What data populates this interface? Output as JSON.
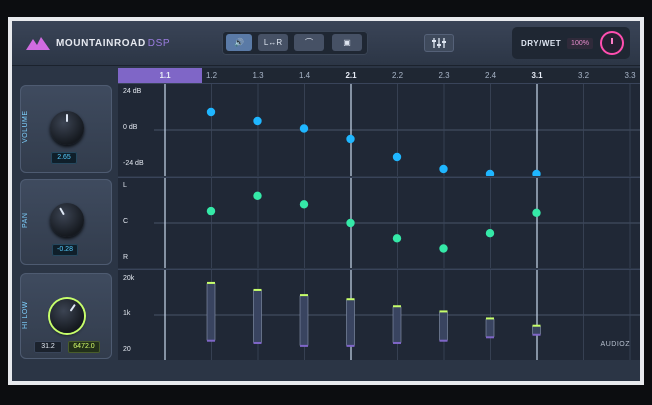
{
  "header": {
    "brand": "MOUNTAINROAD",
    "brand_suffix": "DSP",
    "tools": [
      {
        "name": "speaker-icon",
        "label": "🔊",
        "active": true
      },
      {
        "name": "l-to-r-button",
        "label": "L↔R",
        "active": false
      },
      {
        "name": "curve-icon",
        "label": "⌒",
        "active": false
      },
      {
        "name": "briefcase-icon",
        "label": "▣",
        "active": false
      }
    ],
    "mixer_icon": "sliders-icon",
    "drywet": {
      "label": "DRY/WET",
      "value": "100%"
    }
  },
  "timeline": {
    "ticks": [
      "1.1",
      "1.2",
      "1.3",
      "1.4",
      "2.1",
      "2.2",
      "2.3",
      "2.4",
      "3.1",
      "3.2",
      "3.3"
    ],
    "major": [
      "1.1",
      "2.1",
      "3.1"
    ]
  },
  "volume": {
    "title": "VOLUME",
    "value": "2.65",
    "labels": [
      "24 dB",
      "0 dB",
      "-24 dB"
    ]
  },
  "pan": {
    "title": "PAN",
    "value": "-0.28",
    "labels": [
      "L",
      "C",
      "R"
    ]
  },
  "hilow": {
    "title": "HI LOW",
    "low": "31.2",
    "high": "6472.0",
    "labels": [
      "20k",
      "1k",
      "20"
    ]
  },
  "watermark": "AUDIOZ",
  "lanes": {
    "volume_points_db": [
      12,
      6,
      1,
      -6,
      -18,
      -26,
      -34,
      -42
    ],
    "pan_points": [
      -0.35,
      -0.8,
      -0.55,
      0.0,
      0.45,
      0.75,
      0.3,
      -0.3
    ],
    "filter_bars": [
      {
        "high_k": 15.0,
        "low_k": 0.05
      },
      {
        "high_k": 7.5,
        "low_k": 0.04
      },
      {
        "high_k": 4.5,
        "low_k": 0.03
      },
      {
        "high_k": 3.0,
        "low_k": 0.03
      },
      {
        "high_k": 1.5,
        "low_k": 0.04
      },
      {
        "high_k": 0.9,
        "low_k": 0.05
      },
      {
        "high_k": 0.45,
        "low_k": 0.07
      },
      {
        "high_k": 0.22,
        "low_k": 0.09
      }
    ]
  },
  "colors": {
    "accent": "#7f66c7",
    "volume": "#1fb6ff",
    "pan": "#35e9a8",
    "bar_green": "#c7ff6b",
    "bar_purple": "#7f66c7"
  }
}
